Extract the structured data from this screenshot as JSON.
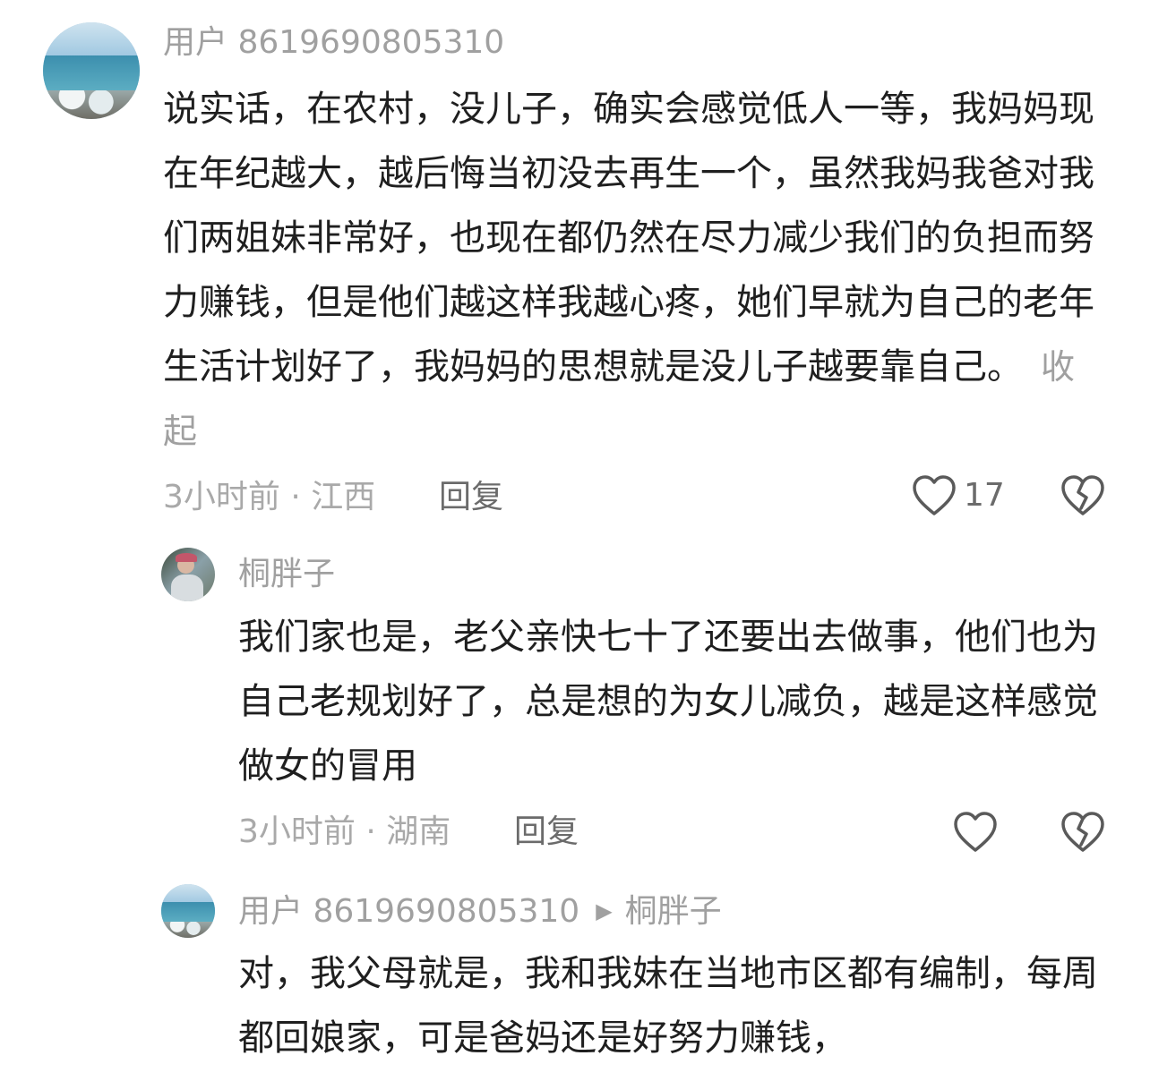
{
  "comments": [
    {
      "username": "用户 8619690805310",
      "text": "说实话，在农村，没儿子，确实会感觉低人一等，我妈妈现在年纪越大，越后悔当初没去再生一个，虽然我妈我爸对我们两姐妹非常好，也现在都仍然在尽力减少我们的负担而努力赚钱，但是他们越这样我越心疼，她们早就为自己的老年生活计划好了，我妈妈的思想就是没儿子越要靠自己。",
      "collapse_label": "收起",
      "meta": "3小时前 · 江西",
      "reply_label": "回复",
      "like_count": "17",
      "avatar_icon": "sea-avatar-icon"
    },
    {
      "username": "桐胖子",
      "text": "我们家也是，老父亲快七十了还要出去做事，他们也为自己老规划好了，总是想的为女儿减负，越是这样感觉做女的冒用",
      "meta": "3小时前 · 湖南",
      "reply_label": "回复",
      "avatar_icon": "person-avatar-icon"
    },
    {
      "username": "用户 8619690805310",
      "reply_to": "桐胖子",
      "text": "对，我父母就是，我和我妹在当地市区都有编制，每周都回娘家，可是爸妈还是好努力赚钱，",
      "avatar_icon": "sea-avatar-icon"
    }
  ],
  "icons": {
    "like": "heart-outline-icon",
    "dislike": "broken-heart-icon",
    "reply_arrow": "right-triangle-icon"
  },
  "colors": {
    "text": "#1f1f1f",
    "muted": "#a0a0a0",
    "icon": "#5a5a5a"
  }
}
